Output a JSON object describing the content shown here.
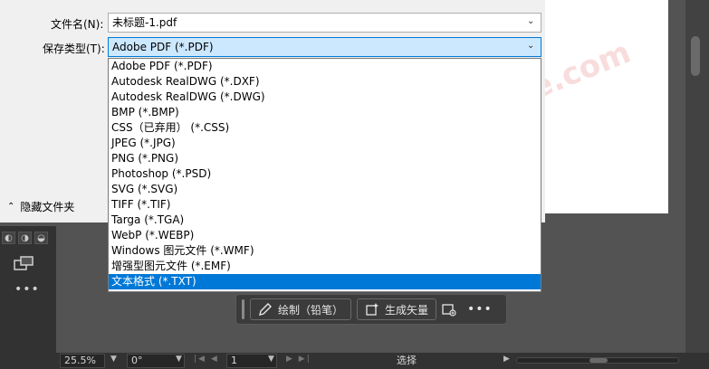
{
  "dialog": {
    "filename_label": "文件名(N):",
    "filename_value": "未标题-1.pdf",
    "filetype_label": "保存类型(T):",
    "filetype_value": "Adobe PDF (*.PDF)",
    "hide_folders": "隐藏文件夹"
  },
  "dropdown": {
    "options": [
      "Adobe PDF (*.PDF)",
      "Autodesk RealDWG (*.DXF)",
      "Autodesk RealDWG (*.DWG)",
      "BMP (*.BMP)",
      "CSS（已弃用） (*.CSS)",
      "JPEG (*.JPG)",
      "PNG (*.PNG)",
      "Photoshop (*.PSD)",
      "SVG (*.SVG)",
      "TIFF (*.TIF)",
      "Targa (*.TGA)",
      "WebP (*.WEBP)",
      "Windows 图元文件 (*.WMF)",
      "增强型图元文件 (*.EMF)",
      "文本格式 (*.TXT)"
    ],
    "highlighted_index": 14
  },
  "context_bar": {
    "draw_label": "绘制（铅笔）",
    "generate_label": "生成矢量"
  },
  "statusbar": {
    "zoom": "25.5%",
    "rotation": "0°",
    "artboard": "1",
    "tool": "选择"
  },
  "watermark": "家·黑域基地 www.Hybase.com",
  "colors": {
    "highlight": "#0078d7",
    "selected_field": "#cce8ff",
    "workspace": "#535353"
  }
}
